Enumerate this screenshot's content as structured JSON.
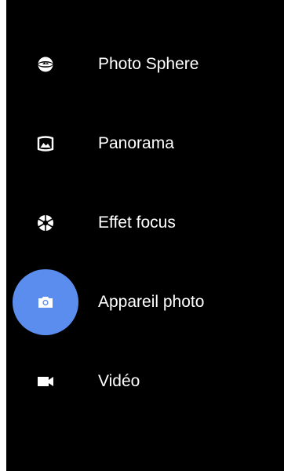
{
  "theme": {
    "background": "#000000",
    "accent": "#5b8def",
    "text": "#ffffff"
  },
  "mode_menu": {
    "items": [
      {
        "label": "Photo Sphere",
        "icon": "photo-sphere-icon",
        "selected": false
      },
      {
        "label": "Panorama",
        "icon": "panorama-icon",
        "selected": false
      },
      {
        "label": "Effet focus",
        "icon": "lens-blur-icon",
        "selected": false
      },
      {
        "label": "Appareil photo",
        "icon": "camera-icon",
        "selected": true
      },
      {
        "label": "Vidéo",
        "icon": "video-camera-icon",
        "selected": false
      }
    ]
  }
}
